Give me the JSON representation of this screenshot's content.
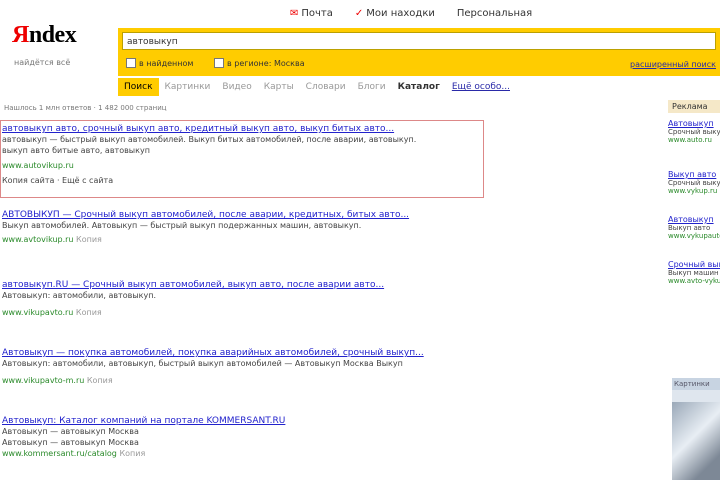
{
  "logo": {
    "first_letter": "Я",
    "rest": "ndex",
    "tagline": "найдётся всё"
  },
  "toplinks": [
    {
      "label": "Почта",
      "mark": "✉"
    },
    {
      "label": "Мои находки",
      "mark": "✓"
    },
    {
      "label": "Персональная",
      "mark": ""
    }
  ],
  "search": {
    "query": "автовыкуп",
    "option1": "в найденном",
    "option2": "в регионе: Москва",
    "advanced": "расширенный поиск"
  },
  "tabs": [
    "Поиск",
    "Картинки",
    "Видео",
    "Карты",
    "Словари",
    "Блоги",
    "Каталог",
    "Ещё особо..."
  ],
  "stats": "Нашлось 1 млн ответов · 1 482 000 страниц",
  "results": [
    {
      "title": "автовыкуп авто, срочный выкуп авто, кредитный выкуп авто, выкуп битых авто...",
      "snippet1": "автовыкуп — быстрый выкуп автомобилей. Выкуп битых автомобилей, после аварии, автовыкуп.",
      "snippet2": "выкуп авто битые авто, автовыкуп",
      "url": "www.autovikup.ru",
      "extra": "Копия сайта · Ещё с сайта"
    },
    {
      "title": "АВТОВЫКУП — Срочный выкуп автомобилей, после аварии, кредитных, битых авто...",
      "snippet1": "Выкуп автомобилей. Автовыкуп — быстрый выкуп подержанных машин, автовыкуп.",
      "url": "www.avtovikup.ru",
      "extra": "Копия"
    },
    {
      "title": "автовыкуп.RU — Срочный выкуп автомобилей, выкуп авто, после аварии авто...",
      "snippet1": "Автовыкуп: автомобили, автовыкуп.",
      "url": "www.vikupavto.ru",
      "extra": "Копия"
    },
    {
      "title": "Автовыкуп — покупка автомобилей, покупка аварийных автомобилей, срочный выкуп...",
      "snippet1": "Автовыкуп: автомобили, автовыкуп, быстрый выкуп автомобилей — Автовыкуп Москва Выкуп",
      "url": "www.vikupavto-m.ru",
      "extra": "Копия"
    },
    {
      "title": "Автовыкуп: Каталог компаний на портале KOMMERSANT.RU",
      "snippet1": "Автовыкуп — автовыкуп Москва",
      "snippet2": "Автовыкуп — автовыкуп Москва",
      "url": "www.kommersant.ru/catalog",
      "extra": "Копия"
    }
  ],
  "sidebar": {
    "header": "Реклама",
    "ads": [
      {
        "title": "Автовыкуп",
        "snippet": "Срочный выкуп авто",
        "url": "www.auto.ru"
      },
      {
        "title": "Выкуп авто",
        "snippet": "Срочный выкуп",
        "url": "www.vykup.ru"
      },
      {
        "title": "Автовыкуп",
        "snippet": "Выкуп авто",
        "url": "www.vykupauto.ru"
      },
      {
        "title": "Срочный выкуп",
        "snippet": "Выкуп машин",
        "url": "www.avto-vykup.ru"
      }
    ],
    "image_bar": "Картинки"
  }
}
